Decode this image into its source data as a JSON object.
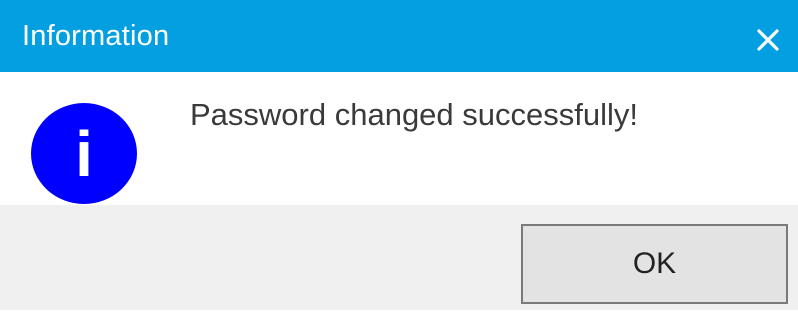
{
  "window": {
    "title": "Information",
    "close_icon": "close-icon",
    "title_bar_color": "#039fe0"
  },
  "content": {
    "icon": "info-icon",
    "icon_glyph": "i",
    "icon_color": "#0000ff",
    "message": "Password changed successfully!"
  },
  "buttons": {
    "ok_label": "OK"
  }
}
